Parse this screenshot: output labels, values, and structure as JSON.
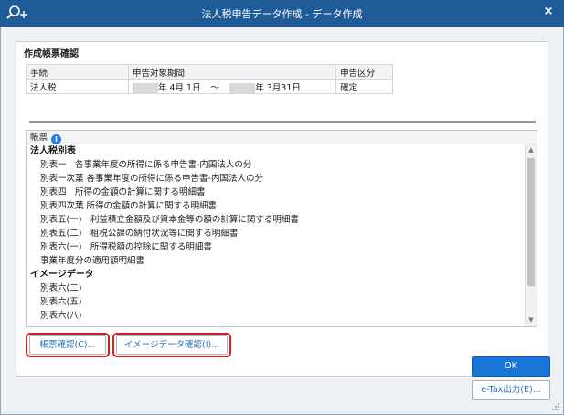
{
  "window": {
    "title": "法人税申告データ作成 - データ作成",
    "close_label": "×"
  },
  "panel": {
    "title": "作成帳票確認"
  },
  "summary": {
    "headers": {
      "procedure": "手続",
      "period": "申告対象期間",
      "category": "申告区分"
    },
    "row": {
      "procedure": "法人税",
      "start": "年 4月 1日",
      "tilde": "～",
      "end": "年 3月31日",
      "category": "確定"
    }
  },
  "forms_list": {
    "header": "帳票",
    "groups": [
      {
        "label": "法人税別表",
        "items": [
          "別表一　各事業年度の所得に係る申告書-内国法人の分",
          "別表一次葉 各事業年度の所得に係る申告書-内国法人の分",
          "別表四　所得の金額の計算に関する明細書",
          "別表四次葉 所得の金額の計算に関する明細書",
          "別表五(一)　利益積立金額及び資本金等の額の計算に関する明細書",
          "別表五(二)　租税公課の納付状況等に関する明細書",
          "別表六(一)　所得税額の控除に関する明細書",
          "事業年度分の適用額明細書"
        ]
      },
      {
        "label": "イメージデータ",
        "items": [
          "別表六(二)",
          "別表六(五)",
          "別表六(八)"
        ]
      }
    ]
  },
  "buttons": {
    "form_check": "帳票確認(C)...",
    "image_check": "イメージデータ確認(I)...",
    "ok": "OK",
    "etax": "e-Tax出力(E)..."
  },
  "colors": {
    "title_bar": "#1f5c97",
    "highlight": "#d91c1c",
    "ok_button": "#1876d6"
  }
}
